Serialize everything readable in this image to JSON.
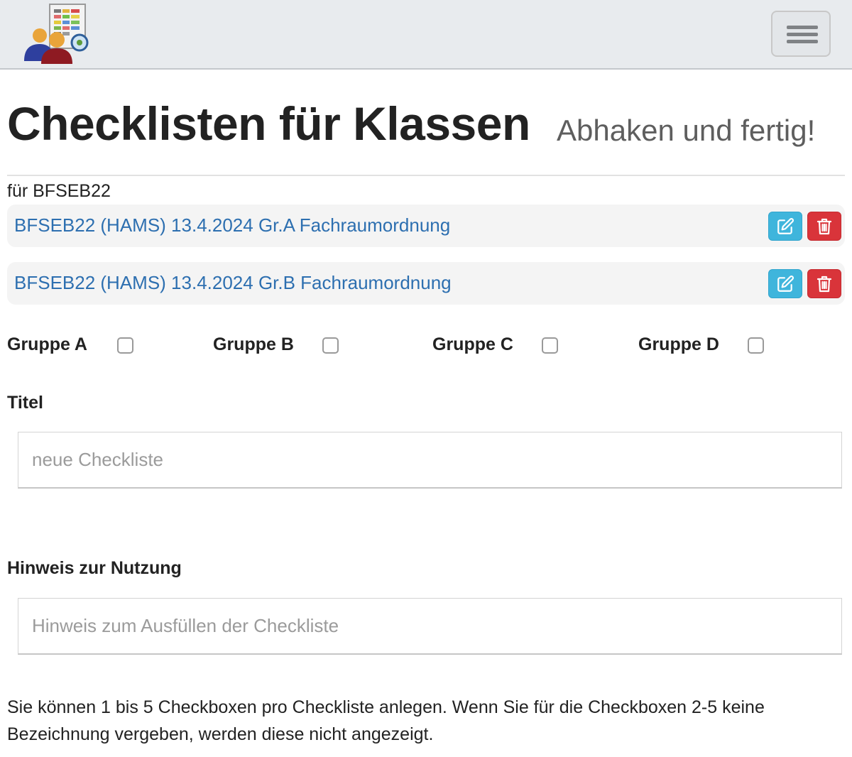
{
  "header": {
    "logo_icon": "group-checklist-logo-icon",
    "menu_icon": "hamburger-menu-icon"
  },
  "page": {
    "title": "Checklisten für Klassen",
    "subtitle": "Abhaken und fertig!"
  },
  "class_label": "für BFSEB22",
  "checklists": [
    {
      "label": "BFSEB22 (HAMS) 13.4.2024 Gr.A Fachraumordnung",
      "edit_icon": "edit-icon",
      "delete_icon": "trash-icon"
    },
    {
      "label": "BFSEB22 (HAMS) 13.4.2024 Gr.B Fachraumordnung",
      "edit_icon": "edit-icon",
      "delete_icon": "trash-icon"
    }
  ],
  "groups": [
    {
      "label": "Gruppe A",
      "checked": false
    },
    {
      "label": "Gruppe B",
      "checked": false
    },
    {
      "label": "Gruppe C",
      "checked": false
    },
    {
      "label": "Gruppe D",
      "checked": false
    }
  ],
  "form": {
    "title_label": "Titel",
    "title_value": "",
    "title_placeholder": "neue Checkliste",
    "hint_label": "Hinweis zur Nutzung",
    "hint_value": "",
    "hint_placeholder": "Hinweis zum Ausfüllen der Checkliste"
  },
  "help_text": "Sie können 1 bis 5 Checkboxen pro Checkliste anlegen. Wenn Sie für die Checkboxen 2-5 keine Bezeichnung vergeben, werden diese nicht angezeigt.",
  "colors": {
    "navbar": "#e8ebee",
    "link": "#2d6fb0",
    "edit_button": "#3fb5dc",
    "delete_button": "#d9343a"
  }
}
